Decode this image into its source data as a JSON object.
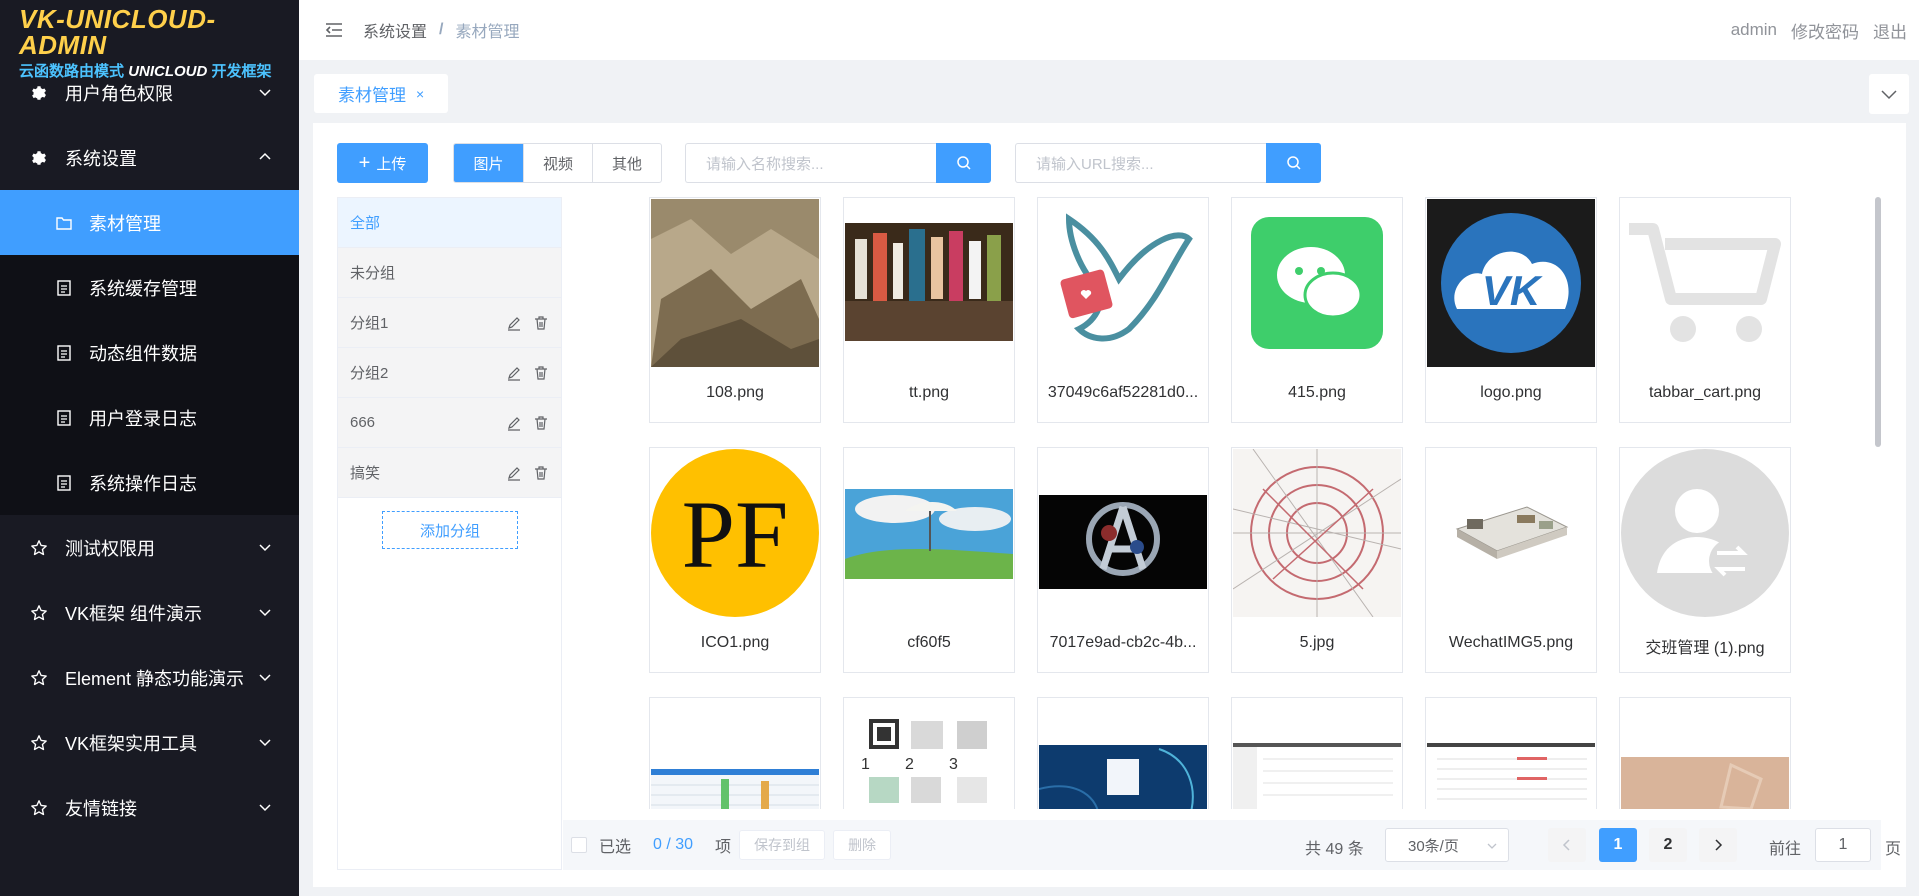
{
  "logo": {
    "title": "VK-UNICLOUD-ADMIN",
    "sub1": "云函数路由模式",
    "sub2": "UNICLOUD",
    "sub3": "开发框架"
  },
  "sidebar": {
    "items": [
      {
        "label": "用户角色权限",
        "icon": "gear-icon"
      },
      {
        "label": "系统设置",
        "icon": "gear-icon",
        "expanded": true,
        "children": [
          {
            "label": "素材管理",
            "icon": "folder-icon",
            "active": true
          },
          {
            "label": "系统缓存管理",
            "icon": "document-icon"
          },
          {
            "label": "动态组件数据",
            "icon": "document-icon"
          },
          {
            "label": "用户登录日志",
            "icon": "document-icon"
          },
          {
            "label": "系统操作日志",
            "icon": "document-icon"
          }
        ]
      },
      {
        "label": "测试权限用",
        "icon": "star-icon"
      },
      {
        "label": "VK框架 组件演示",
        "icon": "star-icon"
      },
      {
        "label": "Element 静态功能演示",
        "icon": "star-icon"
      },
      {
        "label": "VK框架实用工具",
        "icon": "star-icon"
      },
      {
        "label": "友情链接",
        "icon": "star-icon"
      }
    ]
  },
  "header": {
    "breadcrumb": [
      "系统设置",
      "素材管理"
    ],
    "user": "admin",
    "change_password": "修改密码",
    "logout": "退出"
  },
  "tabs": {
    "active": "素材管理",
    "close": "×"
  },
  "toolbar": {
    "upload": "上传",
    "types": [
      "图片",
      "视频",
      "其他"
    ],
    "active_type": "图片",
    "name_search_placeholder": "请输入名称搜索...",
    "url_search_placeholder": "请输入URL搜索..."
  },
  "groups": [
    {
      "label": "全部",
      "active": true,
      "editable": false
    },
    {
      "label": "未分组",
      "editable": false
    },
    {
      "label": "分组1",
      "editable": true
    },
    {
      "label": "分组2",
      "editable": true
    },
    {
      "label": "666",
      "editable": true
    },
    {
      "label": "搞笑",
      "editable": true
    }
  ],
  "add_group": "添加分组",
  "images": [
    {
      "name": "108.png",
      "thumb": "mountain"
    },
    {
      "name": "tt.png",
      "thumb": "bottles"
    },
    {
      "name": "37049c6af52281d0...",
      "thumb": "dove"
    },
    {
      "name": "415.png",
      "thumb": "wechat"
    },
    {
      "name": "logo.png",
      "thumb": "vk-logo"
    },
    {
      "name": "tabbar_cart.png",
      "thumb": "cart"
    },
    {
      "name": "ICO1.png",
      "thumb": "pf"
    },
    {
      "name": "cf60f5",
      "thumb": "anime"
    },
    {
      "name": "7017e9ad-cb2c-4b...",
      "thumb": "avengers"
    },
    {
      "name": "5.jpg",
      "thumb": "map"
    },
    {
      "name": "WechatIMG5.png",
      "thumb": "model3d"
    },
    {
      "name": "交班管理 (1).png",
      "thumb": "user-swap"
    },
    {
      "name": "",
      "thumb": "screen-table"
    },
    {
      "name": "",
      "thumb": "qr-steps"
    },
    {
      "name": "",
      "thumb": "login-blue"
    },
    {
      "name": "",
      "thumb": "screen-table"
    },
    {
      "name": "",
      "thumb": "screen-table"
    },
    {
      "name": "",
      "thumb": "beige"
    }
  ],
  "footer": {
    "selected_label": "已选",
    "selected_count": "0 / 30",
    "items_unit": "项",
    "save_to_group": "保存到组",
    "delete": "删除",
    "total": "共 49 条",
    "page_size": "30条/页",
    "pages": [
      "1",
      "2"
    ],
    "current_page": "1",
    "goto_label": "前往",
    "goto_value": "1",
    "page_unit": "页"
  },
  "colors": {
    "primary": "#409eff",
    "sidebar_bg": "#191a23",
    "logo_yellow": "#ffd04b"
  }
}
